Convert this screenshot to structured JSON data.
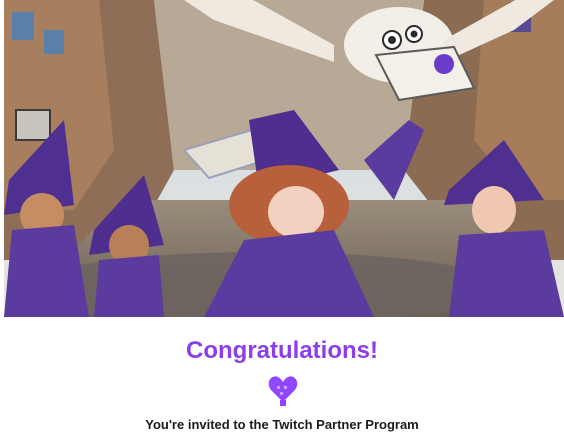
{
  "banner": {
    "image_alt": "Illustrated banner of witches in a busy market street with an owl carrying a Twitch letter"
  },
  "content": {
    "title": "Congratulations!",
    "heart_icon": "twitch-heart-icon",
    "subtitle": "You're invited to the Twitch Partner Program"
  },
  "colors": {
    "title": "#8c3ee8",
    "heart": "#9146ff",
    "text": "#1b1b1b",
    "background": "#ffffff"
  }
}
